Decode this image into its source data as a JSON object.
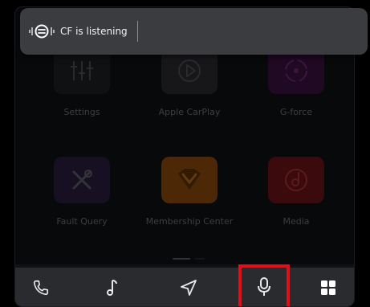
{
  "listening": {
    "text": "CF is listening"
  },
  "apps": [
    {
      "label": "Settings",
      "icon": "sliders-icon"
    },
    {
      "label": "Apple CarPlay",
      "icon": "carplay-icon"
    },
    {
      "label": "G-force",
      "icon": "gauge-icon"
    },
    {
      "label": "Fault Query",
      "icon": "tools-icon"
    },
    {
      "label": "Membership Center",
      "icon": "diamond-icon"
    },
    {
      "label": "Media",
      "icon": "music-disc-icon"
    }
  ],
  "dock": {
    "items": [
      {
        "name": "phone",
        "icon": "phone-icon"
      },
      {
        "name": "music",
        "icon": "music-note-icon"
      },
      {
        "name": "navigation",
        "icon": "navigation-arrow-icon"
      },
      {
        "name": "voice",
        "icon": "microphone-icon",
        "highlighted": true
      },
      {
        "name": "apps",
        "icon": "grid-icon"
      }
    ]
  },
  "colors": {
    "highlight_border": "#e0101a",
    "dock_bg": "#2a2b2f",
    "overlay_bg": "#3b3c40"
  }
}
